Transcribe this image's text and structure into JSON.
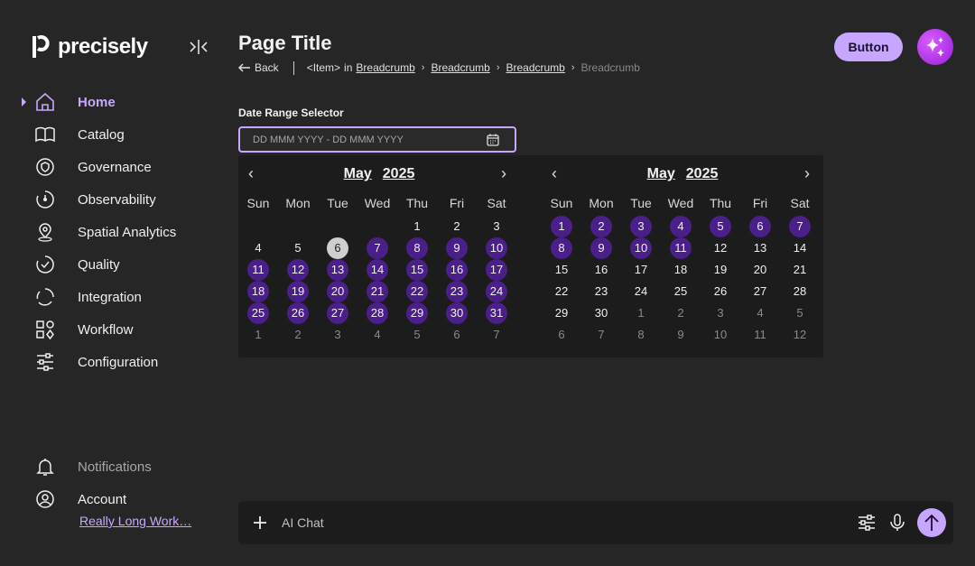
{
  "app": {
    "logo_text": "precisely"
  },
  "sidebar": {
    "items": [
      {
        "label": "Home",
        "icon": "home-icon",
        "active": true
      },
      {
        "label": "Catalog",
        "icon": "book-icon"
      },
      {
        "label": "Governance",
        "icon": "shield-icon"
      },
      {
        "label": "Observability",
        "icon": "observability-icon"
      },
      {
        "label": "Spatial Analytics",
        "icon": "location-pin-icon"
      },
      {
        "label": "Quality",
        "icon": "quality-check-icon"
      },
      {
        "label": "Integration",
        "icon": "integration-icon"
      },
      {
        "label": "Workflow",
        "icon": "workflow-icon"
      },
      {
        "label": "Configuration",
        "icon": "sliders-icon"
      }
    ],
    "bottom": [
      {
        "label": "Notifications",
        "icon": "bell-icon"
      },
      {
        "label": "Account",
        "icon": "account-icon"
      }
    ],
    "workspace": "Really Long Work…"
  },
  "header": {
    "title": "Page Title",
    "back": "Back",
    "breadcrumb_item": "<Item>",
    "breadcrumb_in": "in",
    "breadcrumbs": [
      "Breadcrumb",
      "Breadcrumb",
      "Breadcrumb"
    ],
    "breadcrumb_current": "Breadcrumb",
    "button_label": "Button"
  },
  "date_range": {
    "label": "Date Range Selector",
    "placeholder": "DD MMM YYYY - DD MMM YYYY",
    "weekdays": [
      "Sun",
      "Mon",
      "Tue",
      "Wed",
      "Thu",
      "Fri",
      "Sat"
    ],
    "months": [
      {
        "month": "May",
        "year": "2025",
        "weeks": [
          [
            "",
            "",
            "",
            "",
            "1",
            "2",
            "3"
          ],
          [
            "4",
            "5",
            "6",
            "7",
            "8",
            "9",
            "10"
          ],
          [
            "11",
            "12",
            "13",
            "14",
            "15",
            "16",
            "17"
          ],
          [
            "18",
            "19",
            "20",
            "21",
            "22",
            "23",
            "24"
          ],
          [
            "25",
            "26",
            "27",
            "28",
            "29",
            "30",
            "31"
          ],
          [
            "1",
            "2",
            "3",
            "4",
            "5",
            "6",
            "7"
          ]
        ],
        "today": [
          1,
          2
        ],
        "selected_from": [
          1,
          3
        ],
        "selected_to": [
          4,
          6
        ],
        "outside_from_row": 5
      },
      {
        "month": "May",
        "year": "2025",
        "weeks": [
          [
            "1",
            "2",
            "3",
            "4",
            "5",
            "6",
            "7"
          ],
          [
            "8",
            "9",
            "10",
            "11",
            "12",
            "13",
            "14"
          ],
          [
            "15",
            "16",
            "17",
            "18",
            "19",
            "20",
            "21"
          ],
          [
            "22",
            "23",
            "24",
            "25",
            "26",
            "27",
            "28"
          ],
          [
            "29",
            "30",
            "1",
            "2",
            "3",
            "4",
            "5"
          ],
          [
            "6",
            "7",
            "8",
            "9",
            "10",
            "11",
            "12"
          ]
        ],
        "today": null,
        "selected_from": [
          0,
          0
        ],
        "selected_to": [
          1,
          3
        ],
        "outside_after": [
          4,
          2
        ]
      }
    ]
  },
  "chat": {
    "placeholder": "AI Chat"
  },
  "colors": {
    "accent": "#c7a6ff",
    "selected_day": "#4b1f8a",
    "background": "#262626",
    "panel": "#1c1c1c"
  }
}
